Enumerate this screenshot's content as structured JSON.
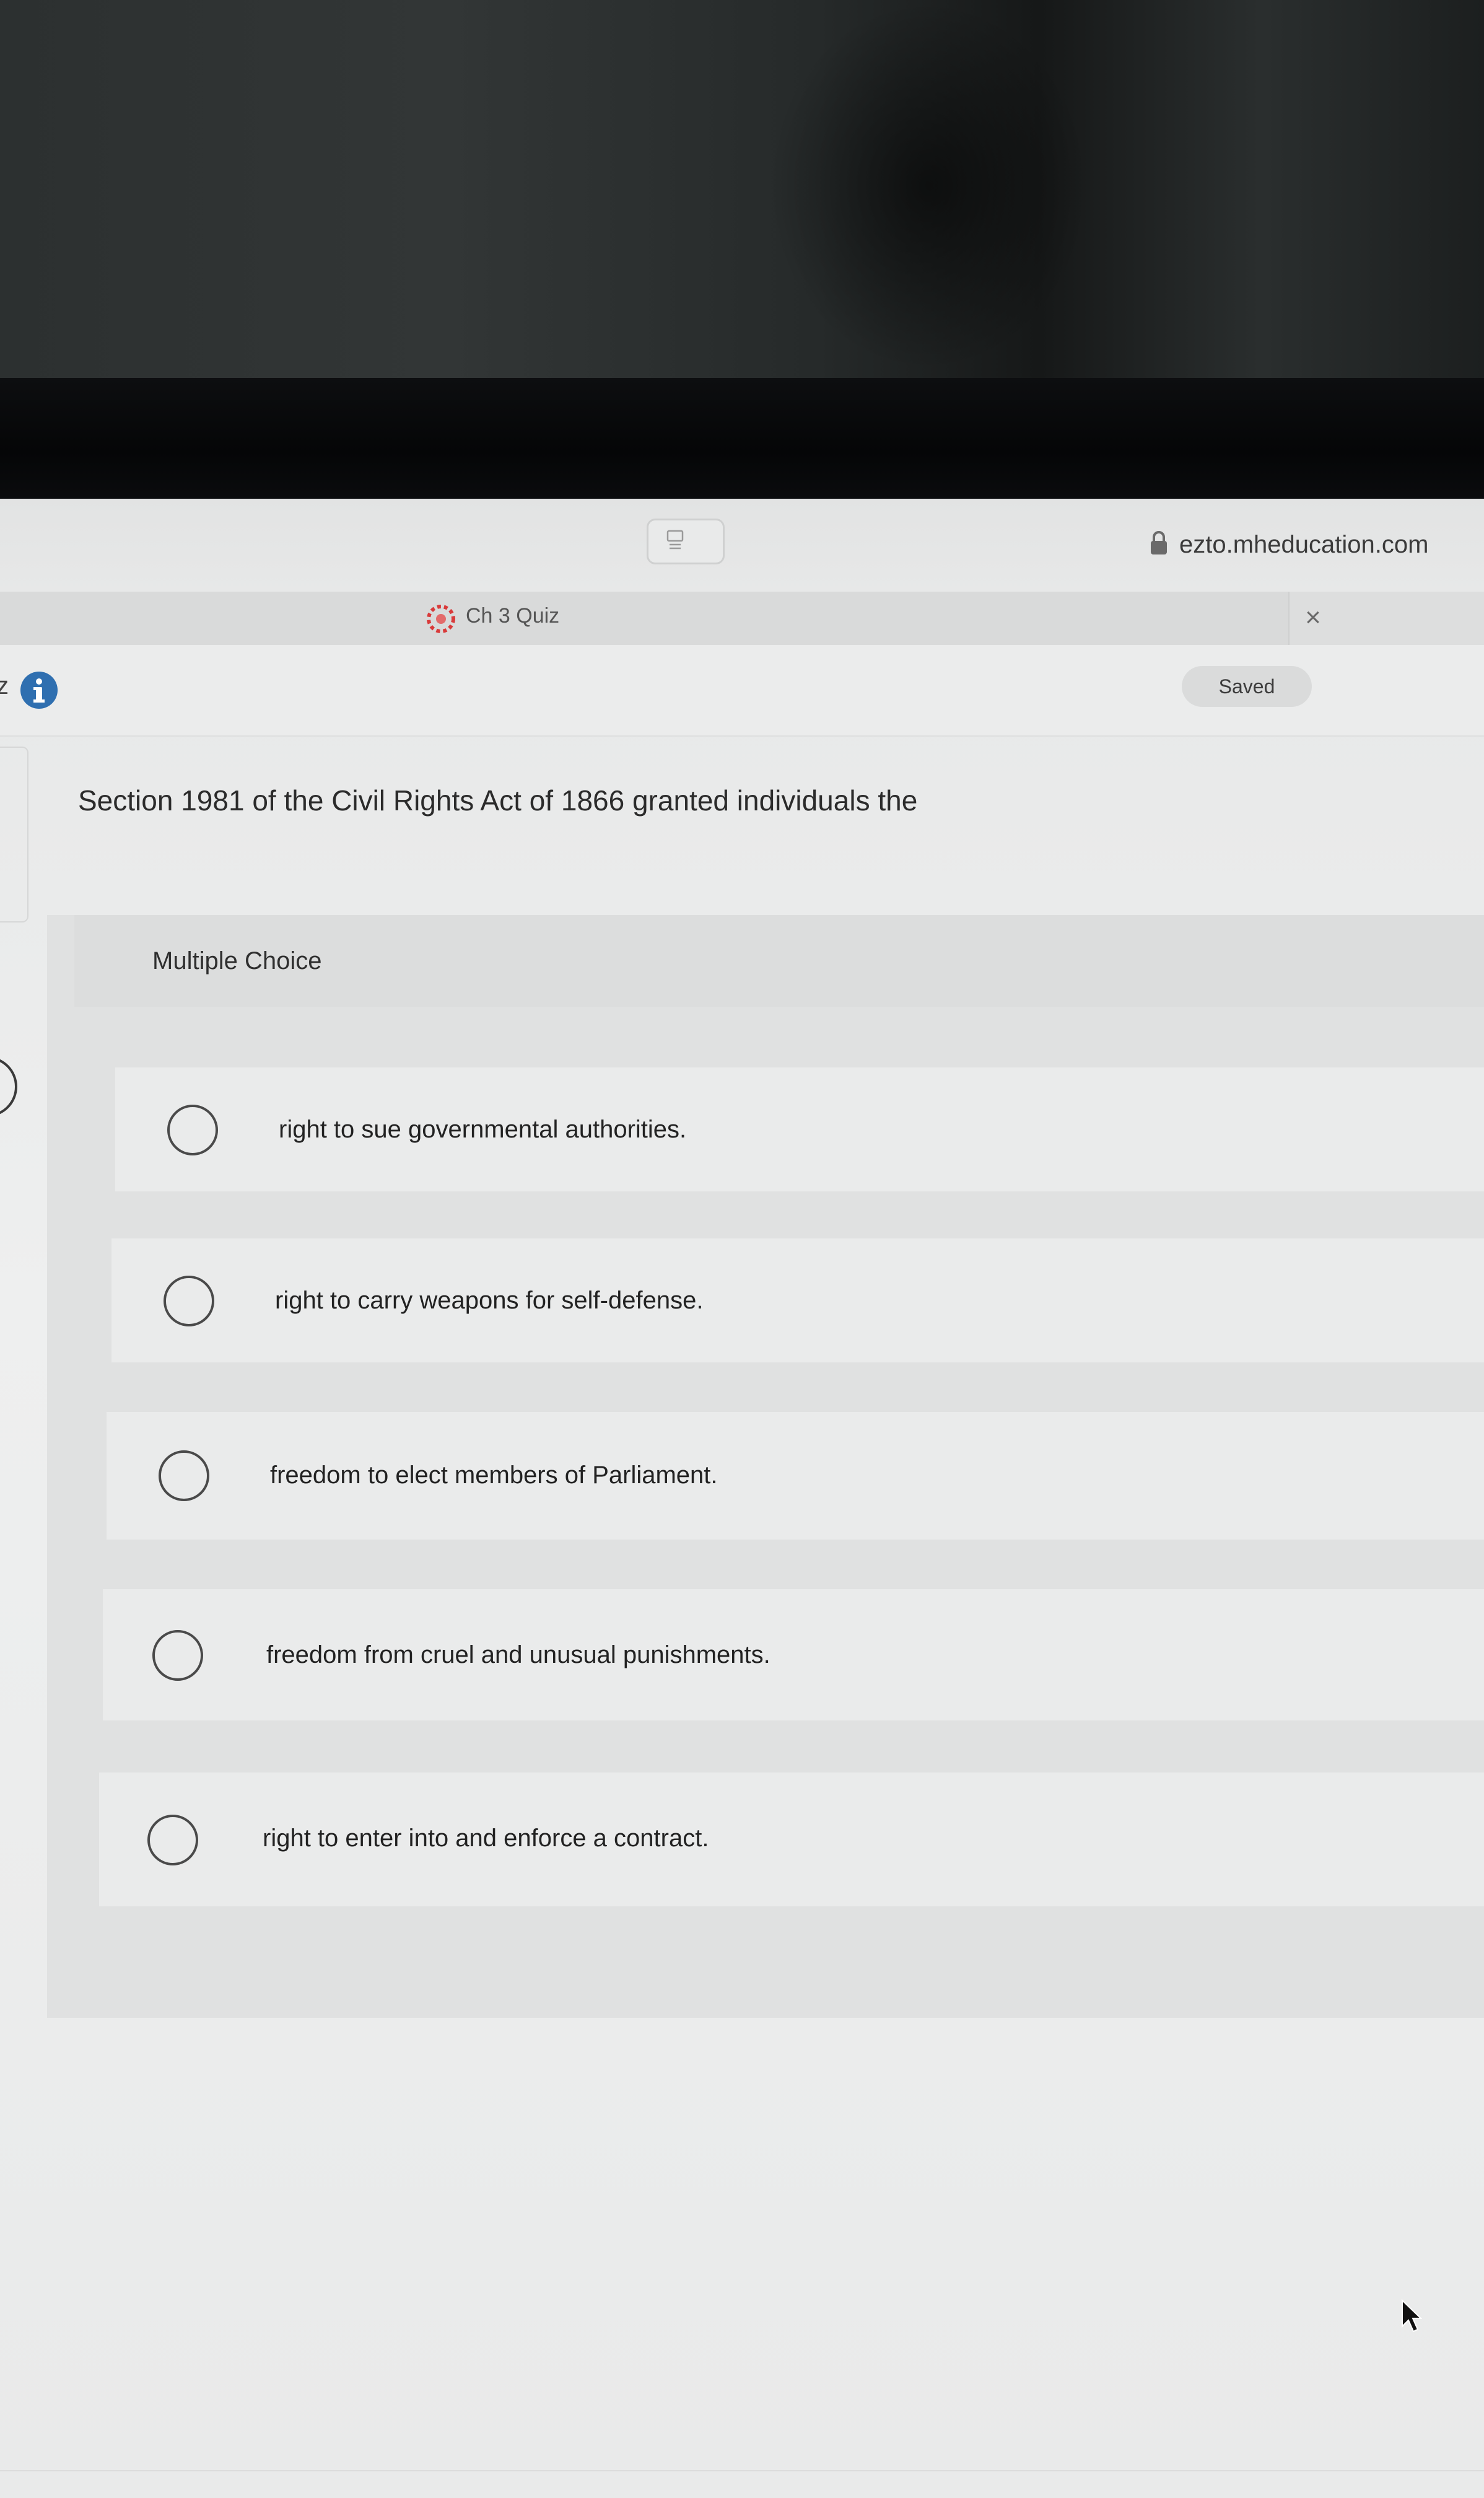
{
  "browser": {
    "url": "ezto.mheducation.com",
    "tab_title": "Ch 3 Quiz",
    "tab_close": "×"
  },
  "quiz_header": {
    "left_fragment": "z",
    "saved_label": "Saved"
  },
  "question": {
    "text": "Section 1981 of the Civil Rights Act of 1866 granted individuals the",
    "type_label": "Multiple Choice",
    "choices": [
      "right to sue governmental authorities.",
      "right to carry weapons for self-defense.",
      "freedom to elect members of Parliament.",
      "freedom from cruel and unusual punishments.",
      "right to enter into and enforce a contract."
    ]
  },
  "colors": {
    "info_icon": "#2f6fb0",
    "favicon": "#d93a3a"
  }
}
